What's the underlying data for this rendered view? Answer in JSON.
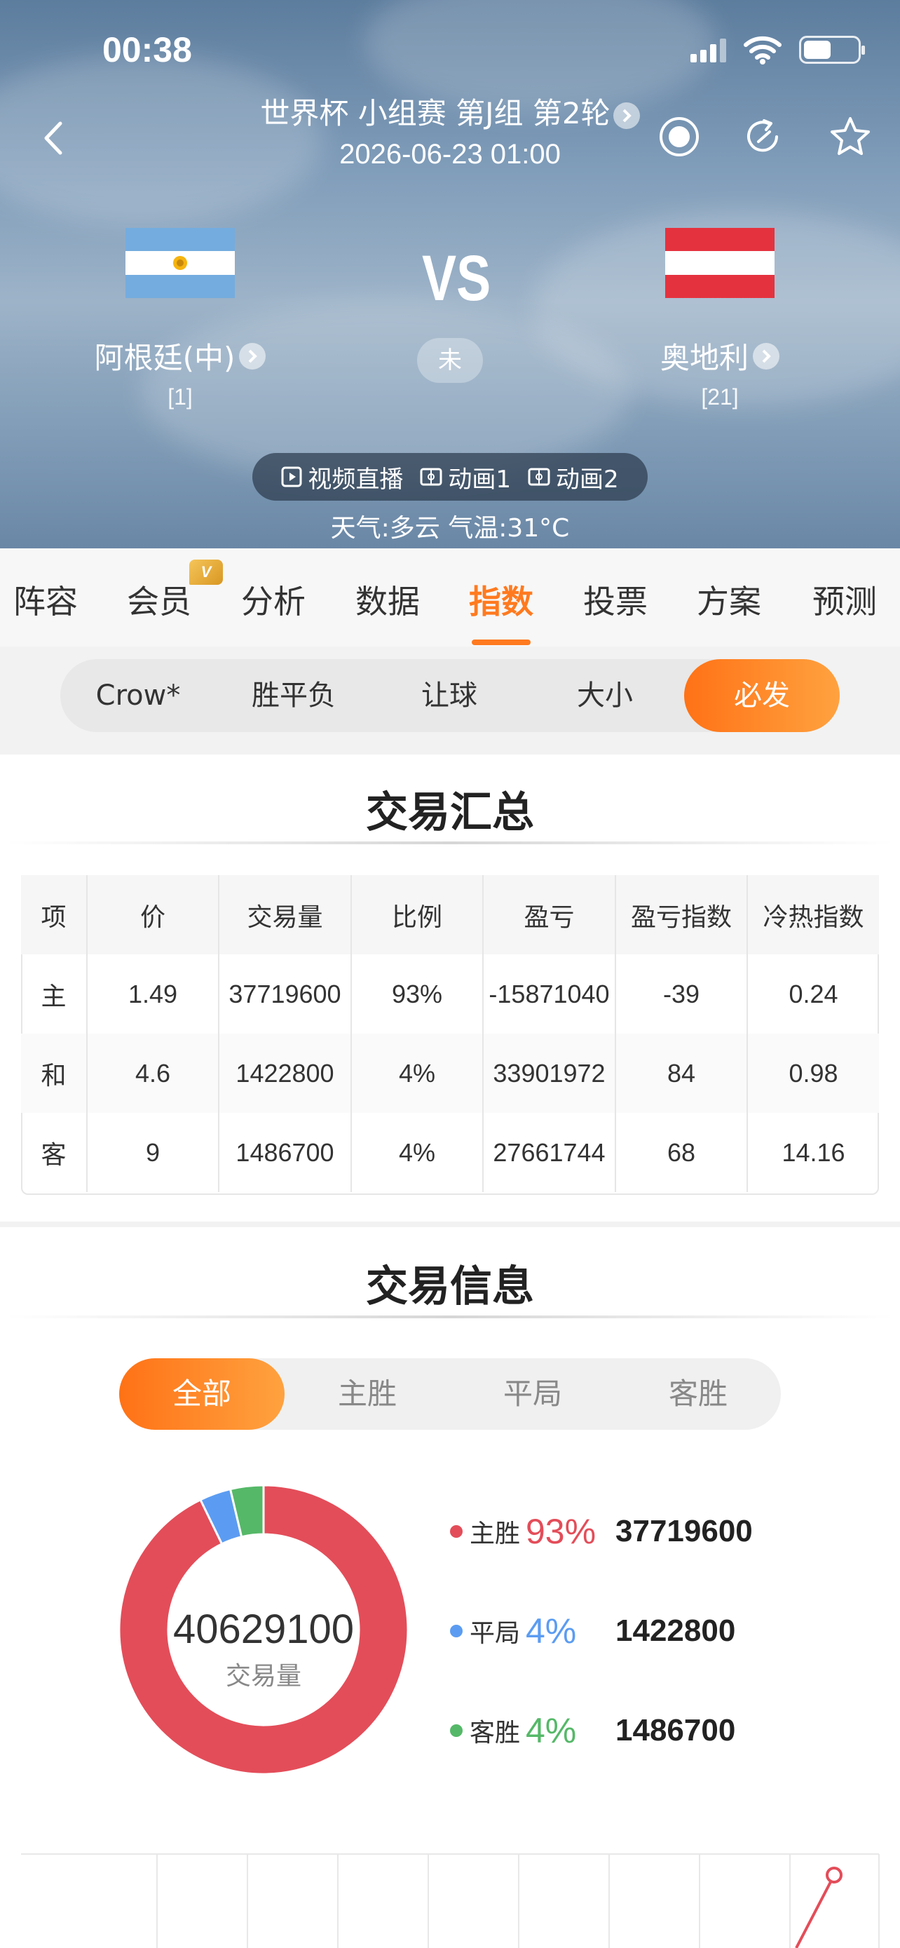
{
  "status_bar": {
    "time": "00:38"
  },
  "match": {
    "competition": "世界杯 小组赛 第J组 第2轮",
    "datetime": "2026-06-23 01:00",
    "vs": "VS",
    "state": "未",
    "home": {
      "name": "阿根廷(中)",
      "rank": "[1]"
    },
    "away": {
      "name": "奥地利",
      "rank": "[21]"
    },
    "live_options": [
      "视频直播",
      "动画1",
      "动画2"
    ],
    "weather": "天气:多云  气温:31°C"
  },
  "nav_tabs": [
    "阵容",
    "会员",
    "分析",
    "数据",
    "指数",
    "投票",
    "方案",
    "预测"
  ],
  "nav_active": "指数",
  "vip_badge": "V",
  "sub_tabs": [
    "Crow*",
    "胜平负",
    "让球",
    "大小",
    "必发"
  ],
  "sub_active": "必发",
  "summary": {
    "title": "交易汇总",
    "headers": [
      "项",
      "价",
      "交易量",
      "比例",
      "盈亏",
      "盈亏指数",
      "冷热指数"
    ],
    "rows": [
      [
        "主",
        "1.49",
        "37719600",
        "93%",
        "-15871040",
        "-39",
        "0.24"
      ],
      [
        "和",
        "4.6",
        "1422800",
        "4%",
        "33901972",
        "84",
        "0.98"
      ],
      [
        "客",
        "9",
        "1486700",
        "4%",
        "27661744",
        "68",
        "14.16"
      ]
    ]
  },
  "info": {
    "title": "交易信息",
    "filters": [
      "全部",
      "主胜",
      "平局",
      "客胜"
    ],
    "filter_active": "全部",
    "total": "40629100",
    "total_label": "交易量",
    "legend": [
      {
        "label": "主胜",
        "pct": "93%",
        "value": "37719600",
        "color": "#e34d59",
        "fraction": 0.928
      },
      {
        "label": "平局",
        "pct": "4%",
        "value": "1422800",
        "color": "#5b9cf2",
        "fraction": 0.035
      },
      {
        "label": "客胜",
        "pct": "4%",
        "value": "1486700",
        "color": "#55b868",
        "fraction": 0.037
      }
    ]
  },
  "colors": {
    "accent": "#ff7a1f",
    "home": "#e34d59",
    "draw": "#5b9cf2",
    "away": "#55b868"
  }
}
